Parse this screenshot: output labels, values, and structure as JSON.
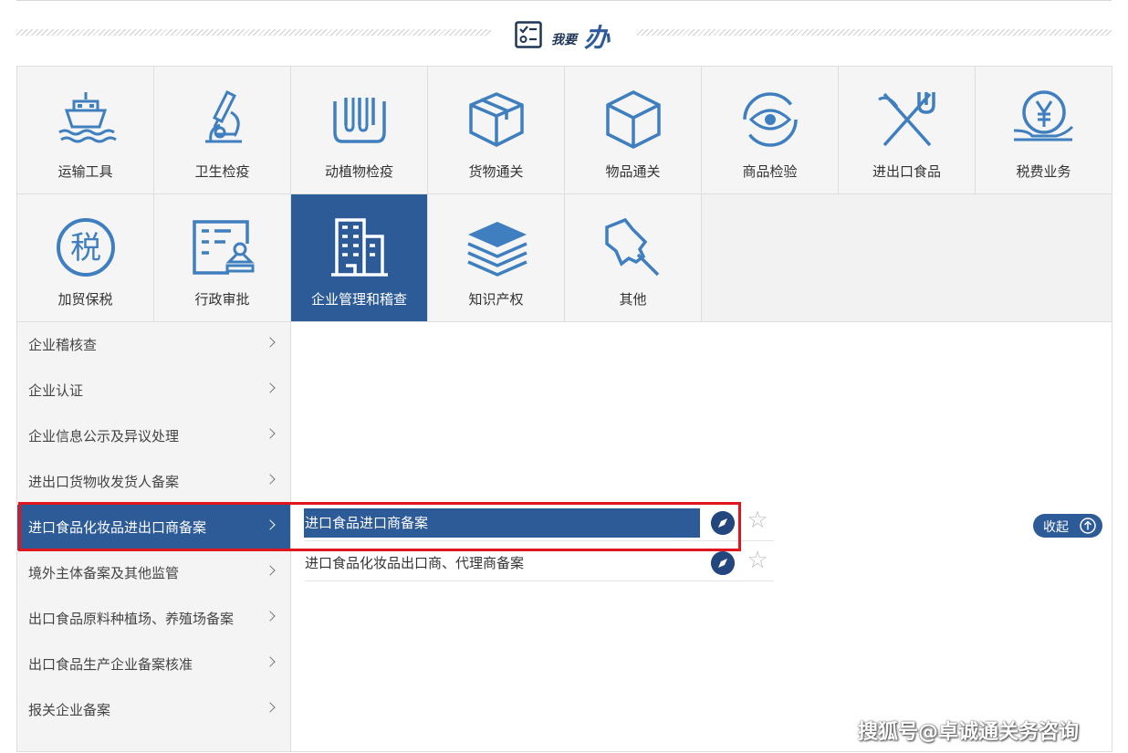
{
  "header": {
    "title_small": "我要",
    "title_big": "办"
  },
  "tiles": [
    {
      "label": "运输工具",
      "icon": "ship-icon"
    },
    {
      "label": "卫生检疫",
      "icon": "microscope-icon"
    },
    {
      "label": "动植物检疫",
      "icon": "test-tubes-icon"
    },
    {
      "label": "货物通关",
      "icon": "open-box-icon"
    },
    {
      "label": "物品通关",
      "icon": "cube-icon"
    },
    {
      "label": "商品检验",
      "icon": "eye-refresh-icon"
    },
    {
      "label": "进出口食品",
      "icon": "fork-knife-icon"
    },
    {
      "label": "税费业务",
      "icon": "yen-hand-icon"
    },
    {
      "label": "加贸保税",
      "icon": "tax-circle-icon"
    },
    {
      "label": "行政审批",
      "icon": "stamp-document-icon"
    },
    {
      "label": "企业管理和稽查",
      "icon": "building-icon"
    },
    {
      "label": "知识产权",
      "icon": "books-icon"
    },
    {
      "label": "其他",
      "icon": "pin-icon"
    }
  ],
  "active_tile_index": 10,
  "sidebar": {
    "items": [
      "企业稽核查",
      "企业认证",
      "企业信息公示及异议处理",
      "进出口货物收发货人备案",
      "进口食品化妆品进出口商备案",
      "境外主体备案及其他监管",
      "出口食品原料种植场、养殖场备案",
      "出口食品生产企业备案核准",
      "报关企业备案"
    ],
    "active_index": 4
  },
  "subitems": [
    {
      "label": "进口食品进口商备案",
      "active": true
    },
    {
      "label": "进口食品化妆品出口商、代理商备案",
      "active": false
    }
  ],
  "collapse_label": "收起",
  "watermark": "搜狐号@卓诚通关务咨询",
  "colors": {
    "primary": "#2d5b98",
    "highlight_border": "#e0161e",
    "icon_blue": "#3f7fc0"
  }
}
